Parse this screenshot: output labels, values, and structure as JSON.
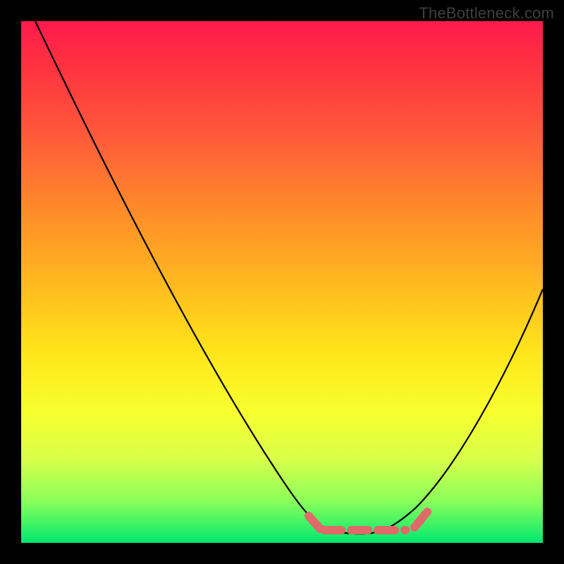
{
  "watermark": "TheBottleneck.com",
  "colors": {
    "background": "#000000",
    "curve": "#000000",
    "marker": "#e06a6a",
    "gradient_top": "#ff1a4d",
    "gradient_bottom": "#00e870"
  },
  "chart_data": {
    "type": "line",
    "title": "",
    "xlabel": "",
    "ylabel": "",
    "xlim": [
      0,
      100
    ],
    "ylim": [
      0,
      100
    ],
    "grid": false,
    "legend": false,
    "series": [
      {
        "name": "bottleneck-curve",
        "x": [
          0,
          5,
          10,
          15,
          20,
          25,
          30,
          35,
          40,
          45,
          50,
          55,
          60,
          62,
          64,
          66,
          68,
          70,
          72,
          76,
          80,
          84,
          88,
          92,
          96,
          100
        ],
        "y": [
          100,
          93,
          86,
          79,
          72,
          64,
          56,
          48,
          40,
          32,
          24,
          16,
          8,
          4,
          2,
          1,
          1,
          2,
          4,
          9,
          16,
          24,
          33,
          42,
          50,
          56
        ]
      }
    ],
    "flat_region": {
      "x_start": 60,
      "x_end": 74,
      "y": 2
    },
    "notes": "V-shaped bottleneck curve; minimum (optimal match) marked by pink dashed segment near bottom."
  }
}
